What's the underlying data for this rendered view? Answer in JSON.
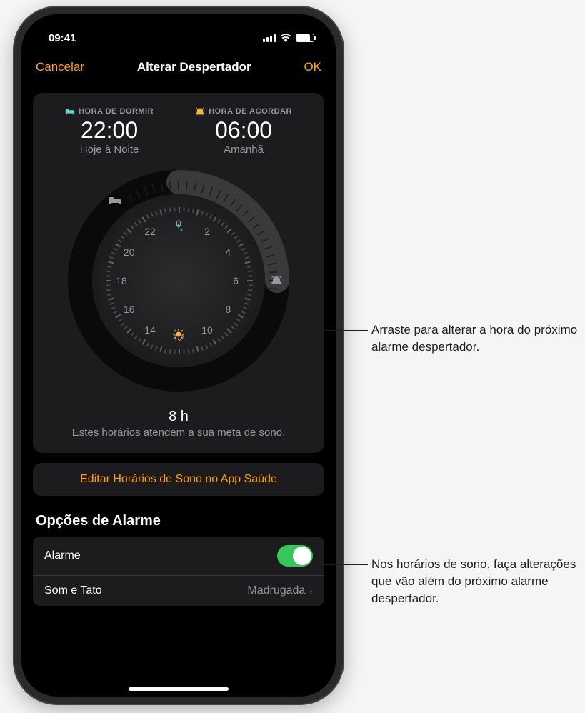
{
  "status": {
    "time": "09:41"
  },
  "nav": {
    "cancel": "Cancelar",
    "title": "Alterar Despertador",
    "ok": "OK"
  },
  "bedtime": {
    "label": "HORA DE DORMIR",
    "time": "22:00",
    "sub": "Hoje à Noite"
  },
  "wake": {
    "label": "HORA DE ACORDAR",
    "time": "06:00",
    "sub": "Amanhã"
  },
  "dial": {
    "hours": [
      "0",
      "2",
      "4",
      "6",
      "8",
      "10",
      "12",
      "14",
      "16",
      "18",
      "20",
      "22"
    ]
  },
  "duration": {
    "value": "8 h",
    "msg": "Estes horários atendem a sua meta de sono."
  },
  "edit_button": "Editar Horários de Sono no App Saúde",
  "alarm_section": "Opções de Alarme",
  "alarm_row": {
    "label": "Alarme"
  },
  "sound_row": {
    "label": "Som e Tato",
    "value": "Madrugada"
  },
  "callout1": "Arraste para alterar a hora do próximo alarme despertador.",
  "callout2": "Nos horários de sono, faça alterações que vão além do próximo alarme despertador."
}
